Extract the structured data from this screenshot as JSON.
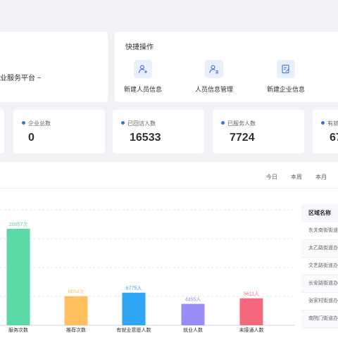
{
  "welcome": {
    "text": "业服务平台 ~"
  },
  "quick_actions": {
    "title": "快捷操作",
    "items": [
      {
        "label": "新建人员信息",
        "icon": "add-user-icon"
      },
      {
        "label": "人员信息管理",
        "icon": "user-list-icon"
      },
      {
        "label": "新建企业信息",
        "icon": "edit-form-icon"
      }
    ]
  },
  "stats": [
    {
      "label": "企业总数",
      "value": "0"
    },
    {
      "label": "已回访人数",
      "value": "16533"
    },
    {
      "label": "已服务人数",
      "value": "7724"
    },
    {
      "label": "有就",
      "value": "67"
    }
  ],
  "range_tabs": [
    "今日",
    "本周",
    "本月"
  ],
  "region_table": {
    "header": "区域名称",
    "rows": [
      "东关南街街道办",
      "太乙路街道办事",
      "文艺路街道办事",
      "长安路街道办事",
      "张家村街道办事",
      "南院门街道办事"
    ]
  },
  "chart_data": {
    "type": "bar",
    "categories": [
      "服务次数",
      "推荐次数",
      "有就业意愿人数",
      "就业人数",
      "未接通人数"
    ],
    "values": [
      20057,
      6054,
      6775,
      4455,
      5611
    ],
    "data_labels": [
      "20057次",
      "6054次",
      "6775人",
      "4455人",
      "5611人"
    ],
    "colors": [
      "#5ad8a6",
      "#ffbf5c",
      "#2fa5f5",
      "#9a8cf5",
      "#f5697f"
    ],
    "ylim": [
      0,
      24000
    ],
    "grid": true
  }
}
